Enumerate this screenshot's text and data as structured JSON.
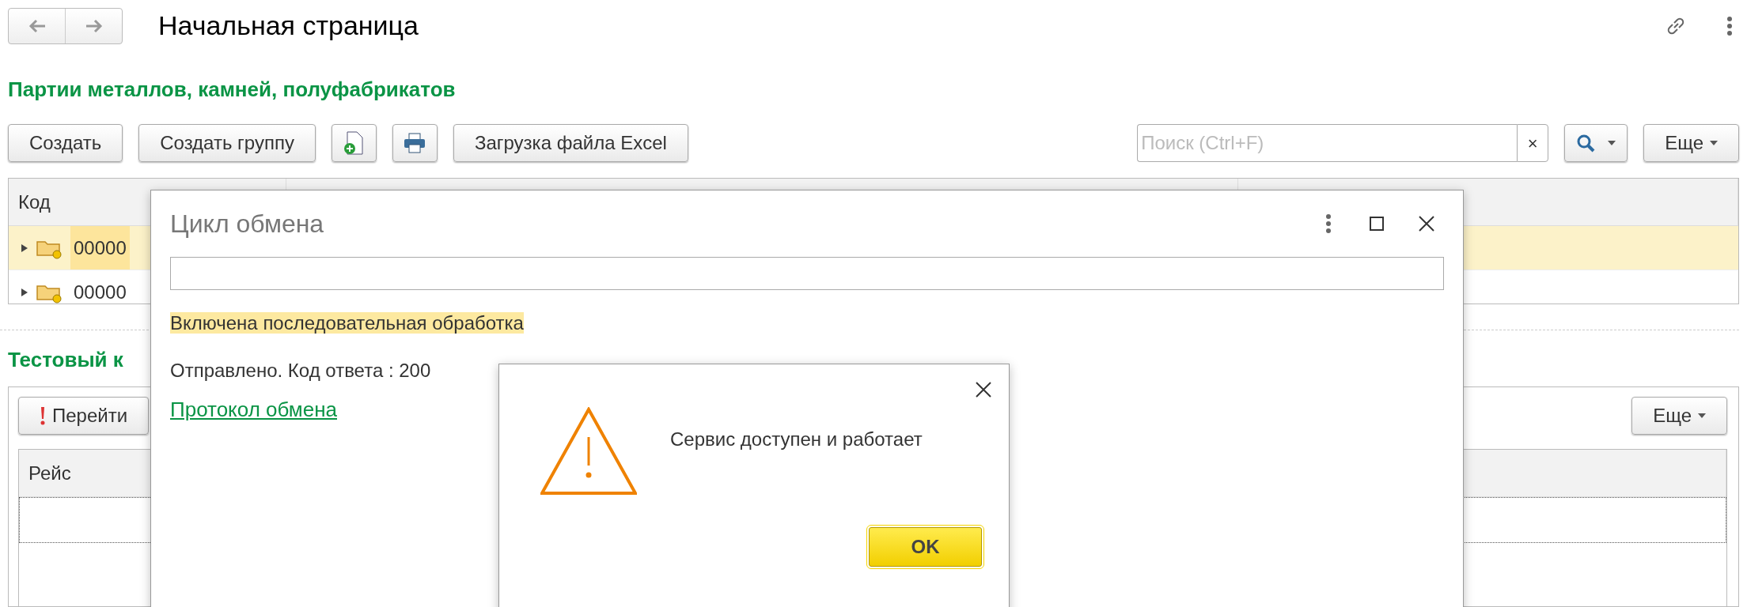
{
  "page_title": "Начальная страница",
  "section1": {
    "title": "Партии металлов, камней, полуфабрикатов",
    "buttons": [
      {
        "kind": "text",
        "label": "Создать"
      },
      {
        "kind": "text",
        "label": "Создать группу"
      },
      {
        "kind": "add-file"
      },
      {
        "kind": "print"
      },
      {
        "kind": "text",
        "label": "Загрузка файла Excel"
      }
    ],
    "search": {
      "placeholder": "Поиск (Ctrl+F)",
      "clear": "×"
    },
    "more_button": "Еще",
    "table": {
      "columns": [
        "Код"
      ],
      "rows": [
        {
          "code": "00000",
          "selected": true,
          "expanded": false
        },
        {
          "code": "00000",
          "selected": false,
          "expanded": false
        }
      ]
    }
  },
  "section2": {
    "title": "Тестовый к",
    "go_button": "Перейти",
    "more_button": "Еще",
    "table": {
      "columns": [
        "Рейс"
      ]
    }
  },
  "dialog": {
    "title": "Цикл обмена",
    "notice": "Включена последовательная обработка",
    "status": "Отправлено. Код ответа : 200",
    "link": "Протокол обмена"
  },
  "message_box": {
    "text": "Сервис доступен и работает",
    "button": "OK"
  }
}
